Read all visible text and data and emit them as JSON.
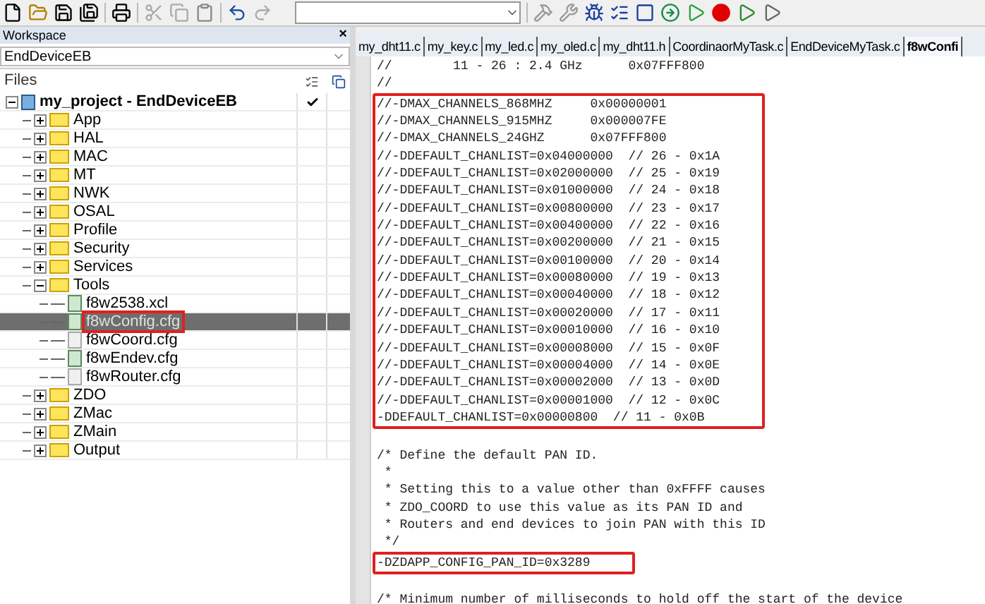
{
  "workspace": {
    "title": "Workspace",
    "close": "×",
    "config": "EndDeviceEB",
    "files_header": "Files",
    "tree": [
      {
        "label": "my_project - EndDeviceEB",
        "kind": "project",
        "checked": true,
        "expanded": true,
        "selected": false,
        "children": [
          {
            "label": "App",
            "kind": "folder",
            "expanded": false,
            "selected": false
          },
          {
            "label": "HAL",
            "kind": "folder",
            "expanded": false,
            "selected": false
          },
          {
            "label": "MAC",
            "kind": "folder",
            "expanded": false,
            "selected": false
          },
          {
            "label": "MT",
            "kind": "folder",
            "expanded": false,
            "selected": false
          },
          {
            "label": "NWK",
            "kind": "folder",
            "expanded": false,
            "selected": false
          },
          {
            "label": "OSAL",
            "kind": "folder",
            "expanded": false,
            "selected": false
          },
          {
            "label": "Profile",
            "kind": "folder",
            "expanded": false,
            "selected": false
          },
          {
            "label": "Security",
            "kind": "folder",
            "expanded": false,
            "selected": false
          },
          {
            "label": "Services",
            "kind": "folder",
            "expanded": false,
            "selected": false
          },
          {
            "label": "Tools",
            "kind": "folder",
            "expanded": true,
            "selected": false,
            "children": [
              {
                "label": "f8w2538.xcl",
                "kind": "file",
                "excluded": false,
                "selected": false,
                "highlighted": false
              },
              {
                "label": "f8wConfig.cfg",
                "kind": "file",
                "excluded": false,
                "selected": true,
                "highlighted": true
              },
              {
                "label": "f8wCoord.cfg",
                "kind": "file",
                "excluded": true,
                "selected": false,
                "highlighted": false
              },
              {
                "label": "f8wEndev.cfg",
                "kind": "file",
                "excluded": false,
                "selected": false,
                "highlighted": false
              },
              {
                "label": "f8wRouter.cfg",
                "kind": "file",
                "excluded": true,
                "selected": false,
                "highlighted": false
              }
            ]
          },
          {
            "label": "ZDO",
            "kind": "folder",
            "expanded": false,
            "selected": false
          },
          {
            "label": "ZMac",
            "kind": "folder",
            "expanded": false,
            "selected": false
          },
          {
            "label": "ZMain",
            "kind": "folder",
            "expanded": false,
            "selected": false
          },
          {
            "label": "Output",
            "kind": "folder",
            "expanded": false,
            "selected": false
          }
        ]
      }
    ]
  },
  "tabs": [
    {
      "label": "my_dht11.c",
      "selected": false
    },
    {
      "label": "my_key.c",
      "selected": false
    },
    {
      "label": "my_led.c",
      "selected": false
    },
    {
      "label": "my_oled.c",
      "selected": false
    },
    {
      "label": "my_dht11.h",
      "selected": false
    },
    {
      "label": "CoordinaorMyTask.c",
      "selected": false
    },
    {
      "label": "EndDeviceMyTask.c",
      "selected": false
    },
    {
      "label": "f8wConfi",
      "selected": true
    }
  ],
  "code_blocks": [
    {
      "highlighted": false,
      "blank_before": false,
      "lines": [
        "//        11 - 26 : 2.4 GHz      0x07FFF800",
        "//"
      ]
    },
    {
      "highlighted": true,
      "blank_before": false,
      "lines": [
        "//-DMAX_CHANNELS_868MHZ     0x00000001",
        "//-DMAX_CHANNELS_915MHZ     0x000007FE",
        "//-DMAX_CHANNELS_24GHZ      0x07FFF800",
        "//-DDEFAULT_CHANLIST=0x04000000  // 26 - 0x1A",
        "//-DDEFAULT_CHANLIST=0x02000000  // 25 - 0x19",
        "//-DDEFAULT_CHANLIST=0x01000000  // 24 - 0x18",
        "//-DDEFAULT_CHANLIST=0x00800000  // 23 - 0x17",
        "//-DDEFAULT_CHANLIST=0x00400000  // 22 - 0x16",
        "//-DDEFAULT_CHANLIST=0x00200000  // 21 - 0x15",
        "//-DDEFAULT_CHANLIST=0x00100000  // 20 - 0x14",
        "//-DDEFAULT_CHANLIST=0x00080000  // 19 - 0x13",
        "//-DDEFAULT_CHANLIST=0x00040000  // 18 - 0x12",
        "//-DDEFAULT_CHANLIST=0x00020000  // 17 - 0x11",
        "//-DDEFAULT_CHANLIST=0x00010000  // 16 - 0x10",
        "//-DDEFAULT_CHANLIST=0x00008000  // 15 - 0x0F",
        "//-DDEFAULT_CHANLIST=0x00004000  // 14 - 0x0E",
        "//-DDEFAULT_CHANLIST=0x00002000  // 13 - 0x0D",
        "//-DDEFAULT_CHANLIST=0x00001000  // 12 - 0x0C",
        "-DDEFAULT_CHANLIST=0x00000800  // 11 - 0x0B"
      ]
    },
    {
      "highlighted": false,
      "blank_before": true,
      "lines": [
        "/* Define the default PAN ID.",
        " *",
        " * Setting this to a value other than 0xFFFF causes",
        " * ZDO_COORD to use this value as its PAN ID and",
        " * Routers and end devices to join PAN with this ID",
        " */"
      ]
    },
    {
      "highlighted": true,
      "blank_before": false,
      "lines": [
        "-DZDAPP_CONFIG_PAN_ID=0x3289"
      ]
    },
    {
      "highlighted": false,
      "blank_before": true,
      "lines": [
        "/* Minimum number of milliseconds to hold off the start of the device"
      ]
    }
  ]
}
